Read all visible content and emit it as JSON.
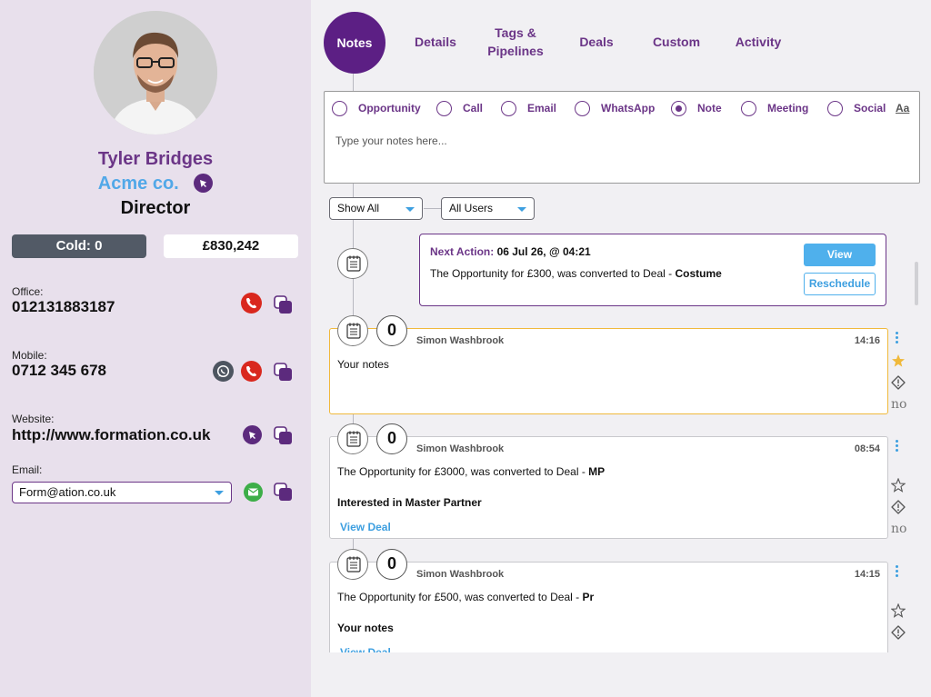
{
  "contact": {
    "name": "Tyler Bridges",
    "company": "Acme co.",
    "title": "Director",
    "status": "Cold: 0",
    "value": "£830,242"
  },
  "fields": {
    "office_label": "Office:",
    "office_value": "012131883187",
    "mobile_label": "Mobile:",
    "mobile_value": "0712 345 678",
    "website_label": "Website:",
    "website_value": "http://www.formation.co.uk",
    "email_label": "Email:",
    "email_value": "Form@ation.co.uk"
  },
  "tabs": {
    "notes": "Notes",
    "details": "Details",
    "tags_line1": "Tags &",
    "tags_line2": "Pipelines",
    "deals": "Deals",
    "custom": "Custom",
    "activity": "Activity"
  },
  "note_types": [
    "Opportunity",
    "Call",
    "Email",
    "WhatsApp",
    "Note",
    "Meeting",
    "Social"
  ],
  "note_type_selected": "Note",
  "font_toggle": "Aa",
  "note_placeholder": "Type your notes here...",
  "filters": {
    "show": "Show All",
    "users": "All Users"
  },
  "next_action": {
    "label": "Next Action:",
    "date": "06 Jul 26, @ 04:21",
    "text": "The Opportunity for £300, was converted to Deal - ",
    "deal": "Costume",
    "view_label": "View",
    "reschedule_label": "Reschedule"
  },
  "notes": [
    {
      "count": "0",
      "author": "Simon Washbrook",
      "time": "14:16",
      "body": "Your notes",
      "side_text": "no",
      "starred": true
    },
    {
      "count": "0",
      "author": "Simon Washbrook",
      "time": "08:54",
      "body": "The Opportunity for £3000, was converted to Deal - ",
      "deal": "MP",
      "sub": "Interested in Master Partner",
      "link": "View Deal",
      "side_text": "no",
      "starred": false
    },
    {
      "count": "0",
      "author": "Simon Washbrook",
      "time": "14:15",
      "body": "The Opportunity for £500, was converted to Deal - ",
      "deal": "Pr",
      "sub": "Your notes",
      "link": "View Deal",
      "starred": false
    }
  ],
  "colors": {
    "brand_purple": "#5c1f84",
    "accent_blue": "#4fb0ec",
    "highlight_gold": "#f0b93b",
    "call_red": "#d9281e",
    "whatsapp_gray": "#4d5560",
    "email_green": "#3dae48"
  }
}
